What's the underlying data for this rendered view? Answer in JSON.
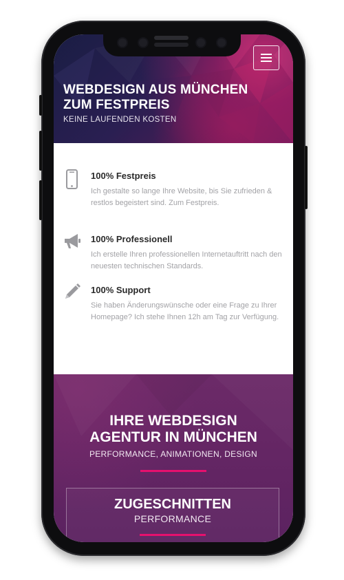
{
  "hero": {
    "title": "WEBDESIGN AUS MÜNCHEN\nZUM FESTPREIS",
    "subtitle": "KEINE LAUFENDEN KOSTEN"
  },
  "navigation": {
    "menu_icon": "hamburger-menu-icon"
  },
  "features": [
    {
      "icon": "smartphone-icon",
      "title": "100% Festpreis",
      "text": "Ich gestalte so lange Ihre Website, bis Sie zufrieden & restlos begeistert sind. Zum Festpreis."
    },
    {
      "icon": "megaphone-icon",
      "title": "100% Professionell",
      "text": "Ich erstelle Ihren professionellen Internetauftritt nach den neuesten technischen Standards."
    },
    {
      "icon": "pencil-icon",
      "title": "100% Support",
      "text": "Sie haben Änderungswünsche oder eine Frage zu Ihrer Homepage? Ich stehe Ihnen 12h am Tag zur Verfügung."
    }
  ],
  "agentur": {
    "title": "IHRE WEBDESIGN\nAGENTUR IN MÜNCHEN",
    "subtitle": "PERFORMANCE, ANIMATIONEN, DESIGN"
  },
  "card": {
    "title": "ZUGESCHNITTEN",
    "subtitle": "PERFORMANCE"
  },
  "colors": {
    "accent": "#e6106e",
    "purple": "#622563",
    "hero_dark": "#1a1d44",
    "text_muted": "#a2a2a6",
    "icon_gray": "#9a9a9e"
  }
}
